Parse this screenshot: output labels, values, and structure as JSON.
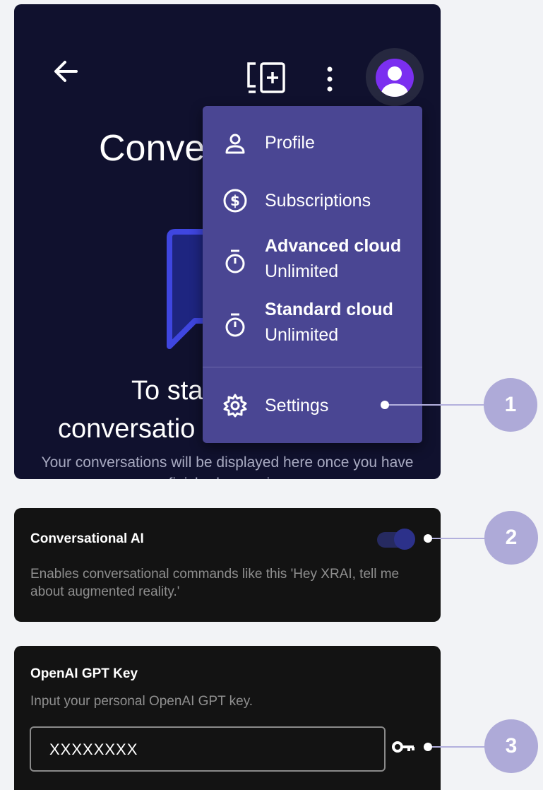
{
  "background_screen": {
    "title_partial": "Conve",
    "empty_line1_partial": "To sta",
    "empty_line2_partial": "conversatio",
    "subtitle": "Your conversations will be displayed here once you have finished a session"
  },
  "topbar": {
    "icons": [
      "back-arrow-icon",
      "new-conversation-icon",
      "more-vertical-icon",
      "avatar-icon"
    ]
  },
  "menu": {
    "profile": "Profile",
    "subscriptions": "Subscriptions",
    "advanced_cloud": {
      "title": "Advanced cloud",
      "value": "Unlimited"
    },
    "standard_cloud": {
      "title": "Standard cloud",
      "value": "Unlimited"
    },
    "settings": "Settings"
  },
  "conversational_ai": {
    "title": "Conversational AI",
    "description": "Enables conversational commands like this 'Hey XRAI, tell me about augmented reality.'",
    "enabled": true
  },
  "openai_key": {
    "title": "OpenAI GPT Key",
    "description": "Input your personal OpenAI GPT key.",
    "value": "XXXXXXXX"
  },
  "callouts": [
    "1",
    "2",
    "3"
  ],
  "colors": {
    "page_bg": "#f2f3f6",
    "app_bg": "#10112e",
    "menu_bg": "#4a4693",
    "card_bg": "#131313",
    "avatar": "#7b2ff0",
    "badge": "#aeaad8",
    "accent_blue": "#3f46e0"
  }
}
